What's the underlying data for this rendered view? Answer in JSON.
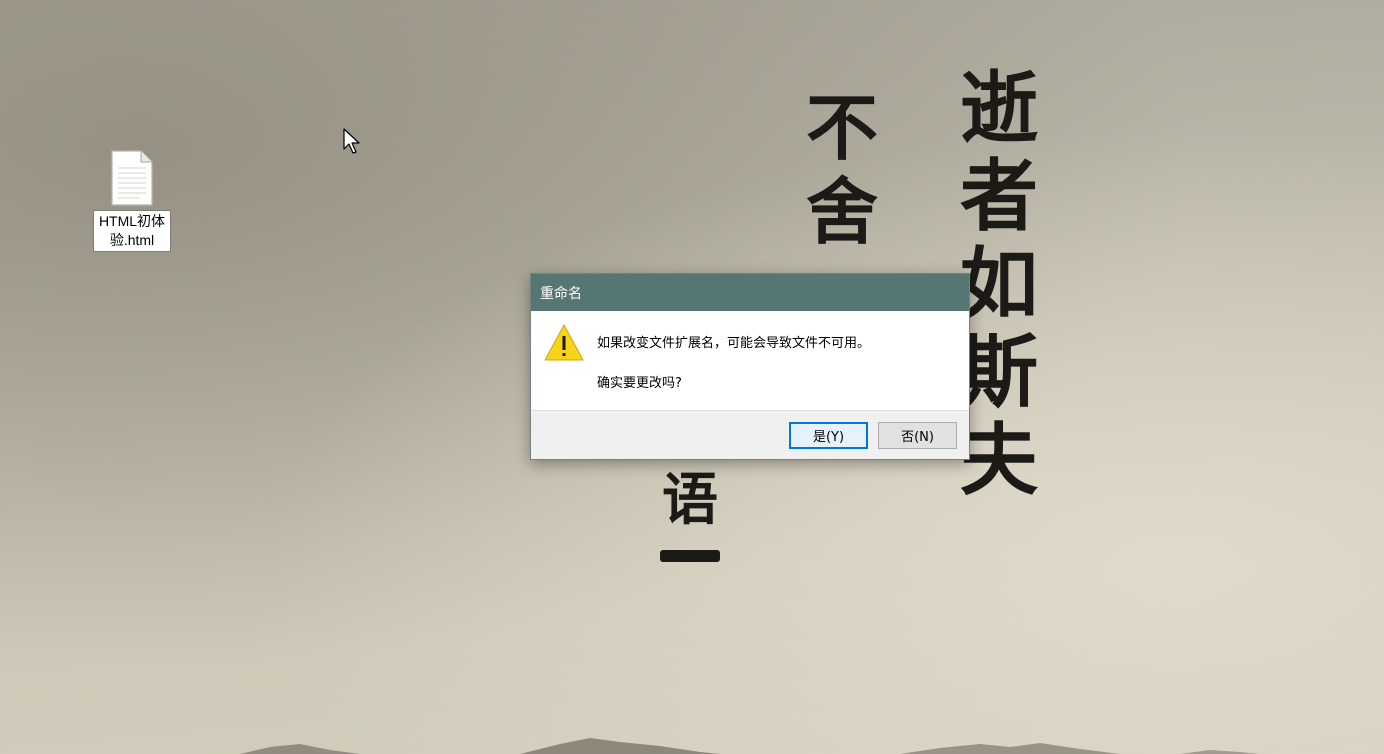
{
  "wallpaper": {
    "calligraphy_right": [
      "逝",
      "者",
      "如",
      "斯",
      "夫"
    ],
    "calligraphy_mid": [
      "不",
      "舍"
    ],
    "calligraphy_small": "语"
  },
  "desktop": {
    "icons": [
      {
        "label": "HTML初体验.html",
        "icon": "document-file-icon"
      }
    ]
  },
  "dialog": {
    "title": "重命名",
    "message": "如果改变文件扩展名，可能会导致文件不可用。",
    "question": "确实要更改吗?",
    "icon": "warning-icon",
    "buttons": {
      "yes_label": "是(Y)",
      "no_label": "否(N)"
    },
    "colors": {
      "titlebar": "#557673",
      "default_button_border": "#0078d7",
      "warning": "#f7d417"
    }
  }
}
